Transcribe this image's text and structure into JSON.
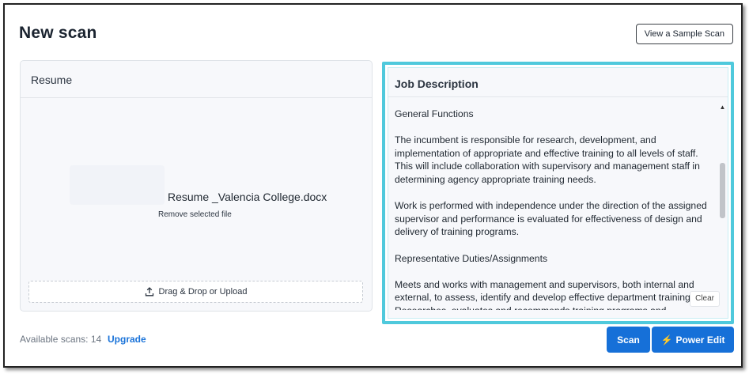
{
  "page": {
    "title": "New scan",
    "sample_button": "View a Sample Scan"
  },
  "resume": {
    "header": "Resume",
    "file_name": "Resume _Valencia College.docx",
    "remove_label": "Remove selected file",
    "upload_label": "Drag & Drop or Upload"
  },
  "job": {
    "header": "Job Description",
    "paragraphs": [
      "General Functions",
      "The incumbent is responsible for research, development, and implementation of appropriate and effective training to all levels of staff. This will include collaboration with supervisory and management staff in determining agency appropriate training needs.",
      "Work is performed with independence under the direction of the assigned supervisor and performance is evaluated for effectiveness of design and delivery of training programs.",
      "Representative Duties/Assignments",
      "Meets and works with management and supervisors, both internal and external, to assess, identify and develop effective department training. Researches, evaluates and recommends training programs and resources"
    ],
    "clear_label": "Clear"
  },
  "footer": {
    "available_scans": "Available scans: 14",
    "upgrade_label": "Upgrade",
    "scan_label": "Scan",
    "power_edit_label": "Power Edit"
  },
  "icons": {
    "upload": "upload-icon",
    "bolt": "lightning-bolt-icon"
  },
  "colors": {
    "primary": "#1670d8",
    "highlight": "#4fc9dc",
    "bolt": "#ffd54a"
  }
}
